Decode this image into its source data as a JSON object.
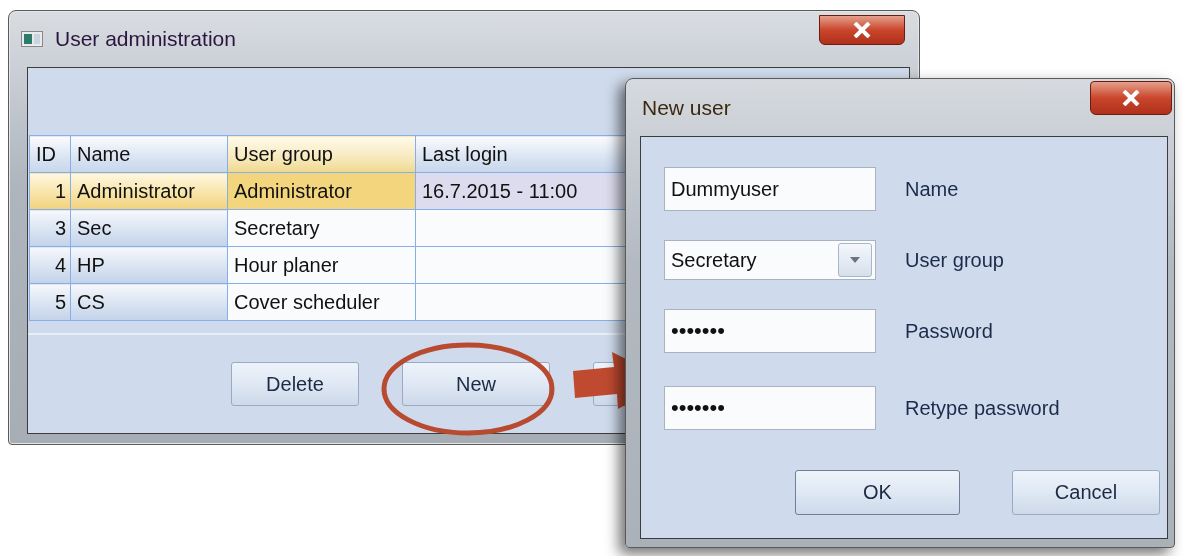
{
  "main_window": {
    "title": "User administration",
    "table": {
      "columns": [
        {
          "label": "ID",
          "highlighted": false
        },
        {
          "label": "Name",
          "highlighted": false
        },
        {
          "label": "User group",
          "highlighted": true
        },
        {
          "label": "Last login",
          "highlighted": false
        }
      ],
      "rows": [
        {
          "id": "1",
          "name": "Administrator",
          "user_group": "Administrator",
          "last_login": "16.7.2015 - 11:00",
          "selected": true
        },
        {
          "id": "3",
          "name": "Sec",
          "user_group": "Secretary",
          "last_login": "",
          "selected": false
        },
        {
          "id": "4",
          "name": "HP",
          "user_group": "Hour planer",
          "last_login": "",
          "selected": false
        },
        {
          "id": "5",
          "name": "CS",
          "user_group": "Cover scheduler",
          "last_login": "",
          "selected": false
        }
      ]
    },
    "buttons": [
      "Delete",
      "New"
    ]
  },
  "dialog": {
    "title": "New user",
    "fields": [
      {
        "kind": "text",
        "value": "Dummyuser",
        "label": "Name"
      },
      {
        "kind": "combo",
        "value": "Secretary",
        "label": "User group"
      },
      {
        "kind": "password",
        "value": "•••••••",
        "label": "Password"
      },
      {
        "kind": "password",
        "value": "•••••••",
        "label": "Retype password"
      }
    ],
    "buttons": [
      {
        "label": "OK",
        "default": true
      },
      {
        "label": "Cancel",
        "default": false
      }
    ]
  }
}
